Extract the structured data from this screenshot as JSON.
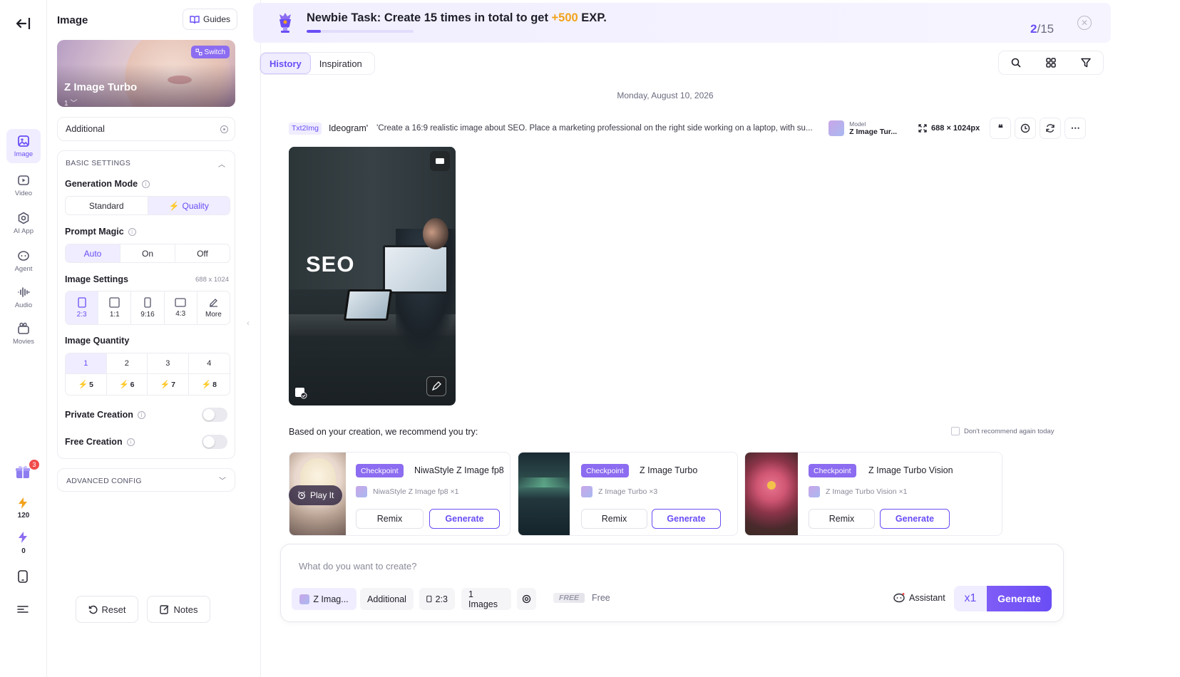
{
  "rail": {
    "items": [
      {
        "label": "Image",
        "icon": "image-icon",
        "active": true
      },
      {
        "label": "Video",
        "icon": "video-icon"
      },
      {
        "label": "AI App",
        "icon": "ai-app-icon"
      },
      {
        "label": "Agent",
        "icon": "agent-icon"
      },
      {
        "label": "Audio",
        "icon": "audio-icon"
      },
      {
        "label": "Movies",
        "icon": "movies-icon"
      }
    ],
    "gift_badge": "3",
    "bolt_count": "120",
    "gem_count": "0"
  },
  "panel": {
    "title": "Image",
    "guides_label": "Guides",
    "model": {
      "name": "Z Image Turbo",
      "version": "1",
      "switch_label": "Switch"
    },
    "additional_label": "Additional",
    "basic_settings_label": "BASIC SETTINGS",
    "generation_mode": {
      "label": "Generation Mode",
      "options": [
        "Standard",
        "Quality"
      ],
      "selected": "Quality"
    },
    "prompt_magic": {
      "label": "Prompt Magic",
      "options": [
        "Auto",
        "On",
        "Off"
      ],
      "selected": "Auto"
    },
    "image_settings": {
      "label": "Image Settings",
      "size": "688 x 1024",
      "ratios": [
        "2:3",
        "1:1",
        "9:16",
        "4:3",
        "More"
      ],
      "selected": "2:3"
    },
    "image_quantity": {
      "label": "Image Quantity",
      "counts": [
        "1",
        "2",
        "3",
        "4"
      ],
      "costs": [
        "5",
        "6",
        "7",
        "8"
      ],
      "selected": "1"
    },
    "private_creation": {
      "label": "Private Creation",
      "on": false
    },
    "free_creation": {
      "label": "Free Creation",
      "on": false
    },
    "advanced_config_label": "ADVANCED CONFIG",
    "reset_label": "Reset",
    "notes_label": "Notes"
  },
  "banner": {
    "title_prefix": "Newbie Task: Create 15 times in total to get ",
    "exp_value": "+500",
    "title_suffix": " EXP.",
    "progress_current": "2",
    "progress_total": "/15",
    "progress_fraction": 0.133
  },
  "tabs": {
    "history": "History",
    "inspiration": "Inspiration"
  },
  "history": {
    "date": "Monday, August 10, 2026",
    "task_type": "Txt2Img",
    "style": "Ideogram'",
    "prompt": "'Create a 16:9 realistic image about SEO. Place a marketing professional on the right side working on a laptop, with su...",
    "model_label": "Model",
    "model_name": "Z Image Tur...",
    "dimensions": "688 × 1024px",
    "image_text": "SEO"
  },
  "recommend": {
    "title": "Based on your creation, we recommend you try:",
    "dont_recommend": "Don't recommend again today",
    "play_label": "Play It",
    "cards": [
      {
        "badge": "Checkpoint",
        "name": "NiwaStyle Z Image fp8",
        "sub": "NiwaStyle Z Image fp8 ×1",
        "remix": "Remix",
        "generate": "Generate"
      },
      {
        "badge": "Checkpoint",
        "name": "Z Image Turbo",
        "sub": "Z Image Turbo ×3",
        "remix": "Remix",
        "generate": "Generate"
      },
      {
        "badge": "Checkpoint",
        "name": "Z Image Turbo Vision",
        "sub": "Z Image Turbo Vision ×1",
        "remix": "Remix",
        "generate": "Generate"
      }
    ]
  },
  "composer": {
    "placeholder": "What do you want to create?",
    "model_chip": "Z Imag...",
    "additional_chip": "Additional",
    "ratio_chip": "2:3",
    "images_chip": "1 Images",
    "free_tag": "FREE",
    "free_label": "Free",
    "assistant_label": "Assistant",
    "multiplier": "x1",
    "generate_label": "Generate"
  },
  "colors": {
    "accent": "#6a4df5",
    "accent_light": "#efedff",
    "exp": "#f2a31b",
    "badge": "#8c6cf0"
  }
}
